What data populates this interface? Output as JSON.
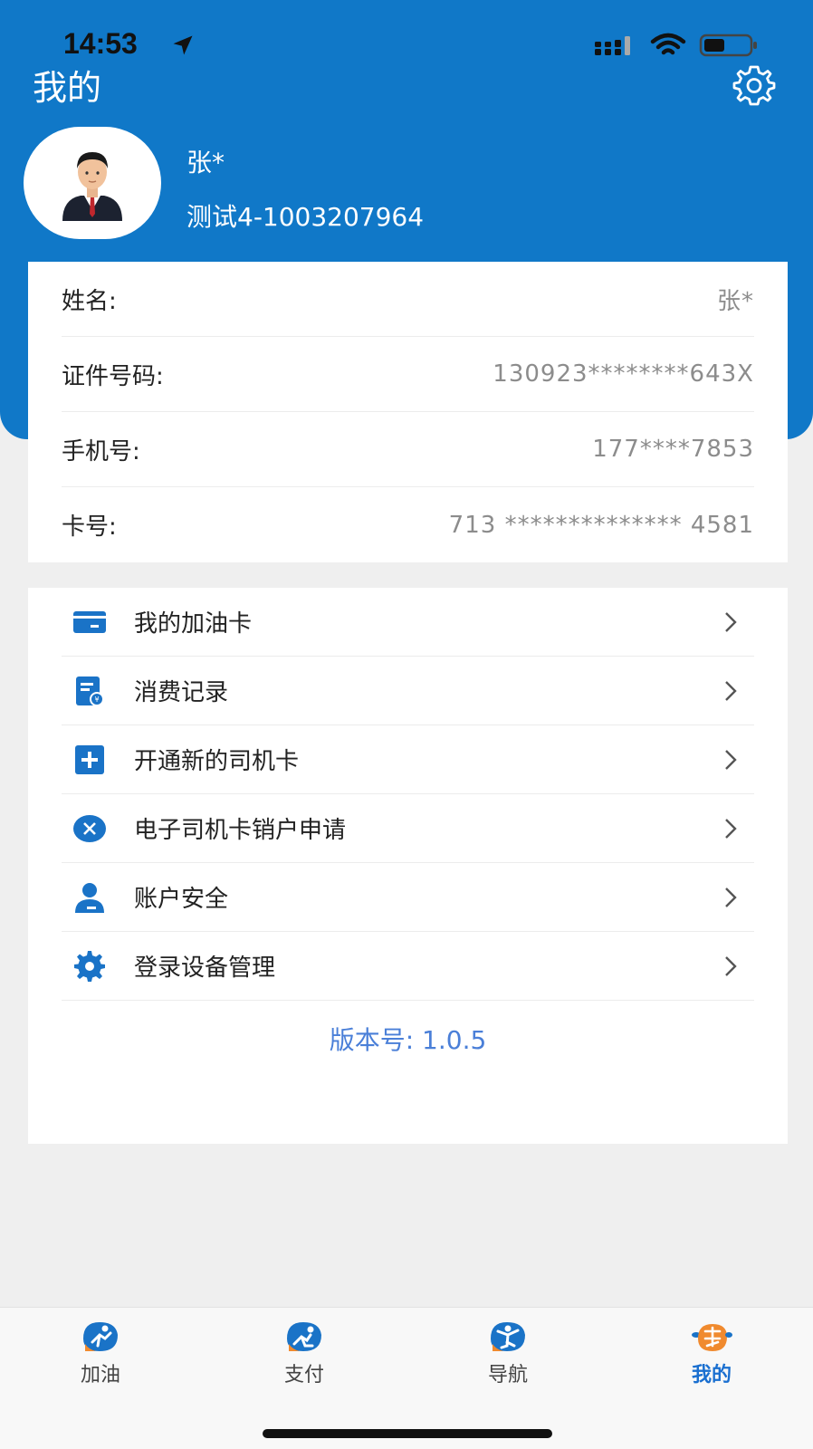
{
  "status": {
    "time": "14:53"
  },
  "header": {
    "title": "我的"
  },
  "user": {
    "name": "张*",
    "account": "测试4-1003207964"
  },
  "info": [
    {
      "label": "姓名:",
      "value": "张*"
    },
    {
      "label": "证件号码:",
      "value": "130923********643X"
    },
    {
      "label": "手机号:",
      "value": "177****7853"
    },
    {
      "label": "卡号:",
      "value": "713 ************** 4581"
    }
  ],
  "menu": [
    {
      "label": "我的加油卡",
      "icon": "fuel-card-icon"
    },
    {
      "label": "消费记录",
      "icon": "receipt-icon"
    },
    {
      "label": "开通新的司机卡",
      "icon": "add-card-icon"
    },
    {
      "label": "电子司机卡销户申请",
      "icon": "cancel-icon"
    },
    {
      "label": "账户安全",
      "icon": "user-security-icon"
    },
    {
      "label": "登录设备管理",
      "icon": "device-gear-icon"
    }
  ],
  "version": "版本号: 1.0.5",
  "tabs": [
    {
      "label": "加油",
      "icon": "refuel-tab-icon"
    },
    {
      "label": "支付",
      "icon": "pay-tab-icon"
    },
    {
      "label": "导航",
      "icon": "nav-tab-icon"
    },
    {
      "label": "我的",
      "icon": "mine-tab-icon"
    }
  ],
  "colors": {
    "brand": "#1078c8",
    "link": "#4a7fd8",
    "active_tab": "#1a6fd0"
  }
}
